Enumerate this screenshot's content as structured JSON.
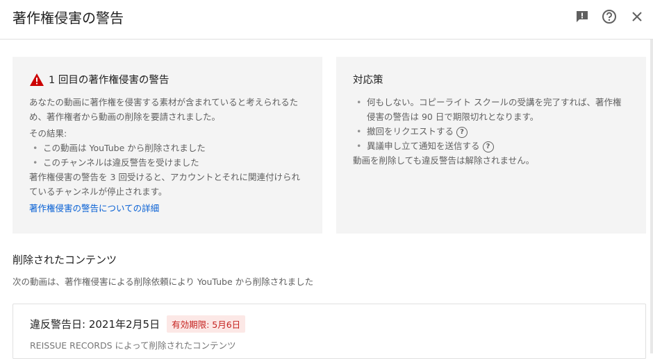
{
  "header": {
    "title": "著作権侵害の警告",
    "icons": [
      "feedback-icon",
      "help-icon",
      "close-icon"
    ]
  },
  "strike_card": {
    "title": "1 回目の著作権侵害の警告",
    "intro": "あなたの動画に著作権を侵害する素材が含まれていると考えられるため、著作権者から動画の削除を要請されました。",
    "result_label": "その結果:",
    "results": [
      "この動画は YouTube から削除されました",
      "このチャンネルは違反警告を受けました"
    ],
    "warning": "著作権侵害の警告を 3 回受けると、アカウントとそれに関連付けられているチャンネルが停止されます。",
    "link": "著作権侵害の警告についての詳細"
  },
  "actions_card": {
    "title": "対応策",
    "items": [
      "何もしない。コピーライト スクールの受講を完了すれば、著作権侵害の警告は 90 日で期限切れとなります。",
      "撤回をリクエストする",
      "異議申し立て通知を送信する"
    ],
    "note": "動画を削除しても違反警告は解除されません。"
  },
  "removed": {
    "heading": "削除されたコンテンツ",
    "subtext": "次の動画は、著作権侵害による削除依頼により YouTube から削除されました",
    "item": {
      "date": "違反警告日: 2021年2月5日",
      "expires": "有効期限: 5月6日",
      "by": "REISSUE RECORDS によって削除されたコンテンツ"
    }
  },
  "colors": {
    "link": "#065fd4",
    "warning": "#cc0000",
    "badge_bg": "#fce8e6",
    "badge_text": "#c5221f"
  }
}
